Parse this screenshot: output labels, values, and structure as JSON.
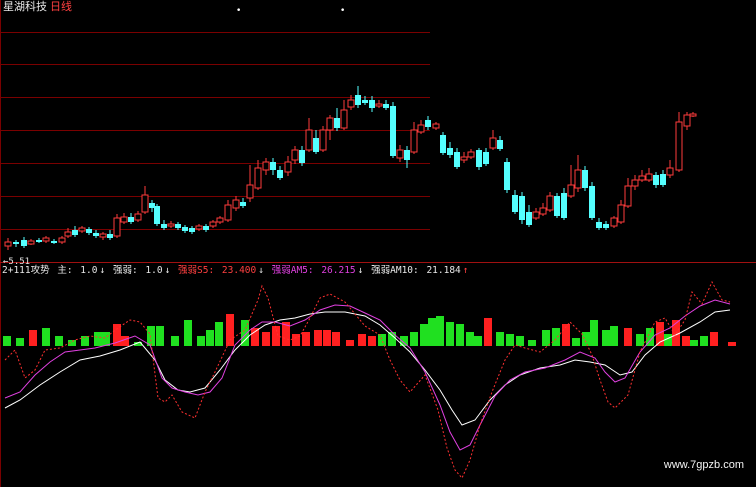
{
  "header": {
    "app_name": "星湖科技",
    "period": "日线"
  },
  "markers": {
    "star": "•"
  },
  "price_panel": {
    "low_label": "←5.51"
  },
  "indicator_bar": {
    "name": "2+111攻势",
    "items": [
      {
        "label": "主:",
        "value": "1.0",
        "arrow": "↓",
        "color": "#e8e8e8",
        "value_color": "#e8e8e8"
      },
      {
        "label": "强弱:",
        "value": "1.0",
        "arrow": "↓",
        "color": "#e8e8e8",
        "value_color": "#e8e8e8"
      },
      {
        "label": "强弱S5:",
        "value": "23.400",
        "arrow": "↓",
        "color": "#ff4040",
        "value_color": "#ff4040"
      },
      {
        "label": "强弱AM5:",
        "value": "26.215",
        "arrow": "↓",
        "color": "#e040e0",
        "value_color": "#e040e0"
      },
      {
        "label": "强弱AM10:",
        "value": "21.184",
        "arrow": "↑",
        "color": "#e8e8e8",
        "value_color": "#e8e8e8"
      }
    ]
  },
  "watermark": "www.7gpzb.com",
  "colors": {
    "up": "#ff3c3c",
    "down": "#54ffff",
    "grid": "#7a0000",
    "hist_up": "#ff2020",
    "hist_down": "#20e020",
    "line_white": "#ffffff",
    "line_magenta": "#e040e0",
    "line_red_dotted": "#ff3030"
  }
}
